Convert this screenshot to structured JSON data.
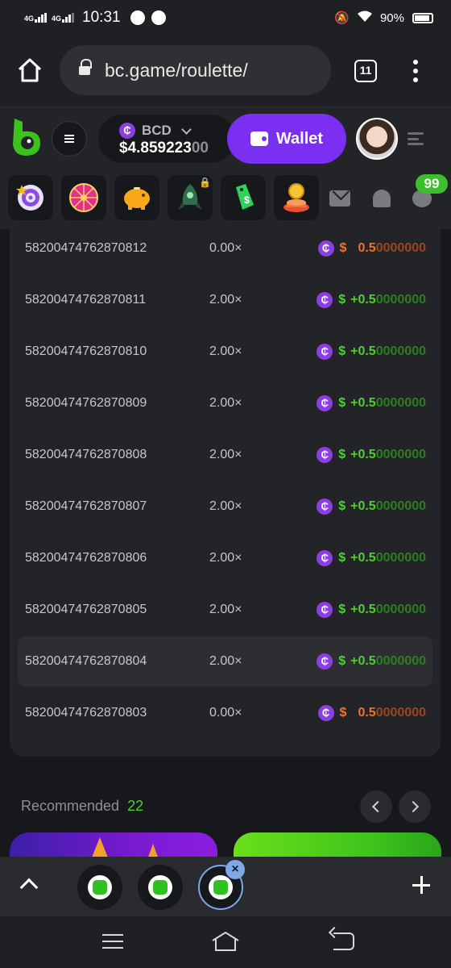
{
  "statusbar": {
    "net1": "4G",
    "net2": "4G",
    "time": "10:31",
    "battery": "90%"
  },
  "browser": {
    "url": "bc.game/roulette/",
    "tab_count": "11"
  },
  "header": {
    "currency": "BCD",
    "balance_main": "$4.859223",
    "balance_fade": "00",
    "wallet_label": "Wallet",
    "coin_symbol": "₵"
  },
  "strip": {
    "games": [
      "spin-target",
      "lucky-wheel",
      "piggy-bank",
      "rocket",
      "cash-tag",
      "coin-pedestal"
    ],
    "chat_badge": "99"
  },
  "bets": [
    {
      "id": "58200474762870812",
      "multiplier": "0.00×",
      "sign": "$",
      "lead": "0.5",
      "tail": "0000000",
      "outcome": "loss"
    },
    {
      "id": "58200474762870811",
      "multiplier": "2.00×",
      "sign": "$",
      "lead": "+0.5",
      "tail": "0000000",
      "outcome": "win"
    },
    {
      "id": "58200474762870810",
      "multiplier": "2.00×",
      "sign": "$",
      "lead": "+0.5",
      "tail": "0000000",
      "outcome": "win"
    },
    {
      "id": "58200474762870809",
      "multiplier": "2.00×",
      "sign": "$",
      "lead": "+0.5",
      "tail": "0000000",
      "outcome": "win"
    },
    {
      "id": "58200474762870808",
      "multiplier": "2.00×",
      "sign": "$",
      "lead": "+0.5",
      "tail": "0000000",
      "outcome": "win"
    },
    {
      "id": "58200474762870807",
      "multiplier": "2.00×",
      "sign": "$",
      "lead": "+0.5",
      "tail": "0000000",
      "outcome": "win"
    },
    {
      "id": "58200474762870806",
      "multiplier": "2.00×",
      "sign": "$",
      "lead": "+0.5",
      "tail": "0000000",
      "outcome": "win"
    },
    {
      "id": "58200474762870805",
      "multiplier": "2.00×",
      "sign": "$",
      "lead": "+0.5",
      "tail": "0000000",
      "outcome": "win"
    },
    {
      "id": "58200474762870804",
      "multiplier": "2.00×",
      "sign": "$",
      "lead": "+0.5",
      "tail": "0000000",
      "outcome": "win",
      "highlighted": true
    },
    {
      "id": "58200474762870803",
      "multiplier": "0.00×",
      "sign": "$",
      "lead": "0.5",
      "tail": "0000000",
      "outcome": "loss"
    }
  ],
  "recommended": {
    "label": "Recommended",
    "count": "22"
  },
  "colors": {
    "accent_purple": "#7b2ff0",
    "win_green": "#4cd12d",
    "loss_orange": "#f0722e",
    "badge_green": "#3cbf2c"
  }
}
